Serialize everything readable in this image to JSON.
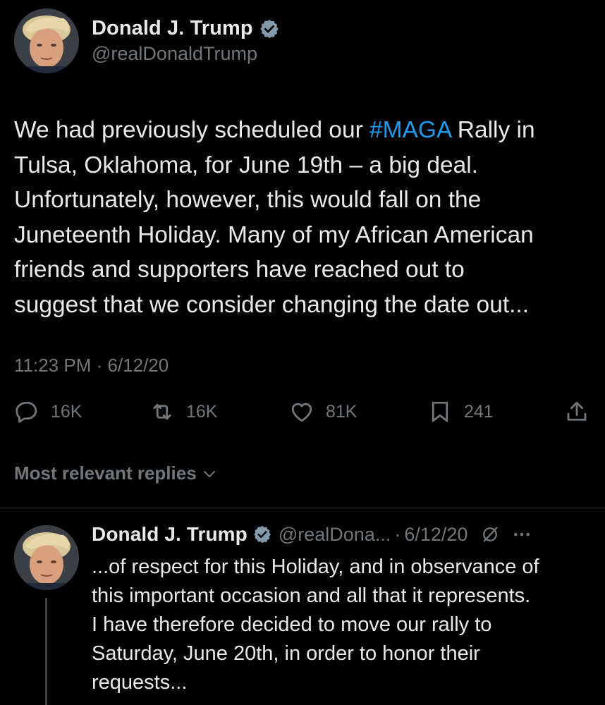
{
  "main_tweet": {
    "author": {
      "display_name": "Donald J. Trump",
      "handle": "@realDonaldTrump",
      "verified_icon": "verified-badge-icon"
    },
    "text_lines": [
      {
        "before": "We had previously scheduled our ",
        "hashtag": "#MAGA",
        "after": " Rally in"
      },
      "Tulsa, Oklahoma, for June 19th – a big deal.",
      "Unfortunately, however, this would fall on the",
      "Juneteenth Holiday. Many of my African American",
      "friends and supporters have reached out to",
      "suggest that we consider changing the date out..."
    ],
    "timestamp": "11:23 PM · 6/12/20",
    "actions": {
      "replies": "16K",
      "retweets": "16K",
      "likes": "81K",
      "bookmarks": "241"
    }
  },
  "replies_filter": {
    "label": "Most relevant replies"
  },
  "reply_tweet": {
    "author": {
      "display_name": "Donald J. Trump",
      "handle": "@realDona...",
      "date": "6/12/20",
      "separator": "·"
    },
    "text_lines": [
      "...of respect for this Holiday, and in observance of",
      "this important occasion and all that it represents.",
      "I have therefore decided to move our rally to",
      "Saturday, June 20th, in order to honor their",
      "requests..."
    ]
  },
  "colors": {
    "background": "#000000",
    "text": "#e7e9ea",
    "secondary_text": "#71767b",
    "link": "#1d9bf0",
    "verified": "#829aab",
    "divider": "#2f3336"
  }
}
